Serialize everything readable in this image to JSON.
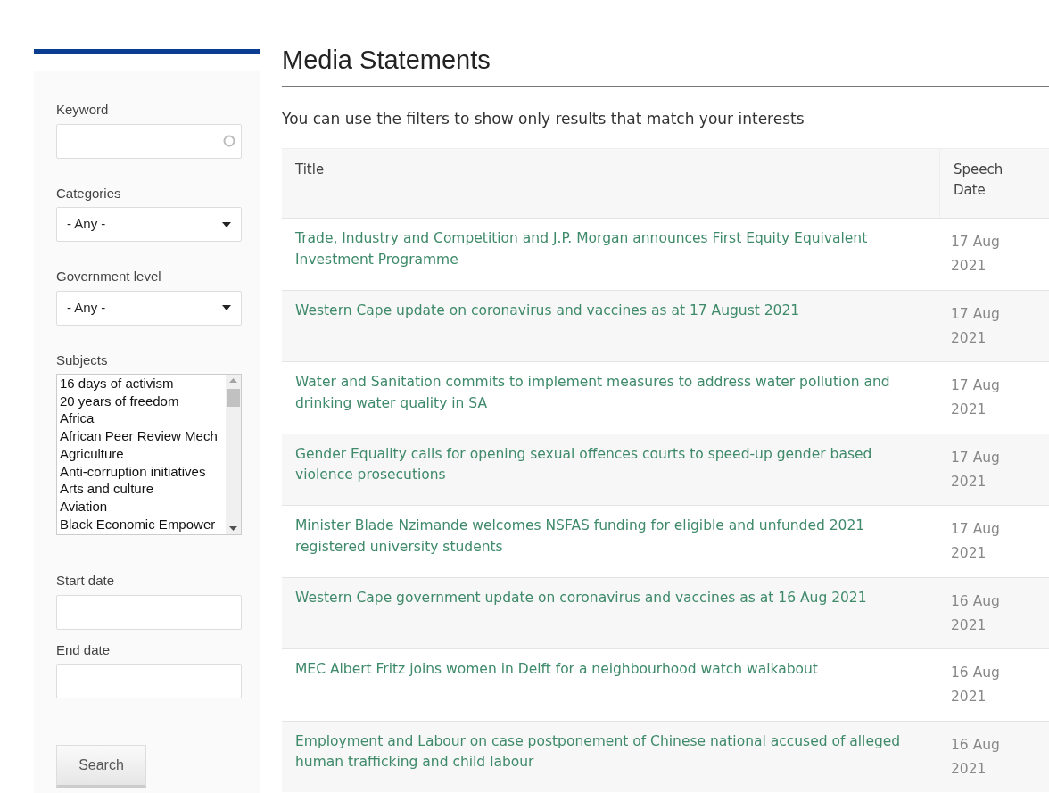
{
  "sidebar": {
    "keyword": {
      "label": "Keyword"
    },
    "categories": {
      "label": "Categories",
      "value": "- Any -"
    },
    "government_level": {
      "label": "Government level",
      "value": "- Any -"
    },
    "subjects": {
      "label": "Subjects",
      "items": [
        "16 days of activism",
        "20 years of freedom",
        "Africa",
        "African Peer Review Mech",
        "Agriculture",
        "Anti-corruption initiatives",
        "Arts and culture",
        "Aviation",
        "Black Economic Empower"
      ]
    },
    "start_date": {
      "label": "Start date"
    },
    "end_date": {
      "label": "End date"
    },
    "search_button": "Search"
  },
  "page_title": "Media Statements",
  "intro": "You can use the filters to show only results that match your interests",
  "table": {
    "columns": [
      "Title",
      "Speech Date"
    ],
    "rows": [
      {
        "title": "Trade, Industry and Competition and J.P. Morgan announces First Equity Equivalent Investment Programme",
        "date": "17 Aug 2021"
      },
      {
        "title": "Western Cape update on coronavirus and vaccines as at 17 August 2021",
        "date": "17 Aug 2021"
      },
      {
        "title": "Water and Sanitation commits to implement measures to address water pollution and drinking water quality in SA",
        "date": "17 Aug 2021"
      },
      {
        "title": "Gender Equality calls for opening sexual offences courts to speed-up gender based violence prosecutions",
        "date": "17 Aug 2021"
      },
      {
        "title": "Minister Blade Nzimande welcomes NSFAS funding for eligible and unfunded 2021 registered university students",
        "date": "17 Aug 2021"
      },
      {
        "title": "Western Cape government update on coronavirus and vaccines as at 16 Aug 2021",
        "date": "16 Aug 2021"
      },
      {
        "title": "MEC Albert Fritz joins women in Delft for a neighbourhood watch walkabout",
        "date": "16 Aug 2021"
      },
      {
        "title": "Employment and Labour on case postponement of Chinese national accused of alleged human trafficking and child labour",
        "date": "16 Aug 2021"
      }
    ]
  }
}
